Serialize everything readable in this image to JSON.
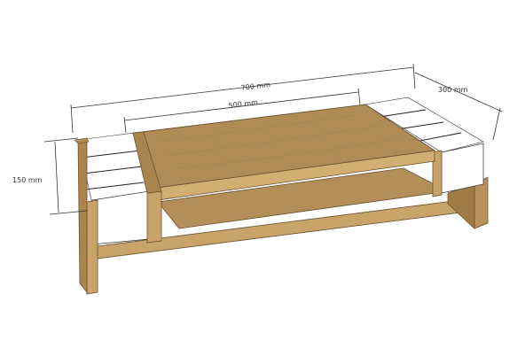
{
  "dimensions": {
    "total_width": "700 mm",
    "inner_width": "500 mm",
    "depth": "300 mm",
    "height": "150 mm"
  },
  "colors": {
    "background": "#ffffff",
    "wood_top": "#b08b55",
    "wood_front": "#c9a46a",
    "wood_dark": "#8c6c3e",
    "panel_white": "#ffffff",
    "dimension_line": "#333333"
  }
}
